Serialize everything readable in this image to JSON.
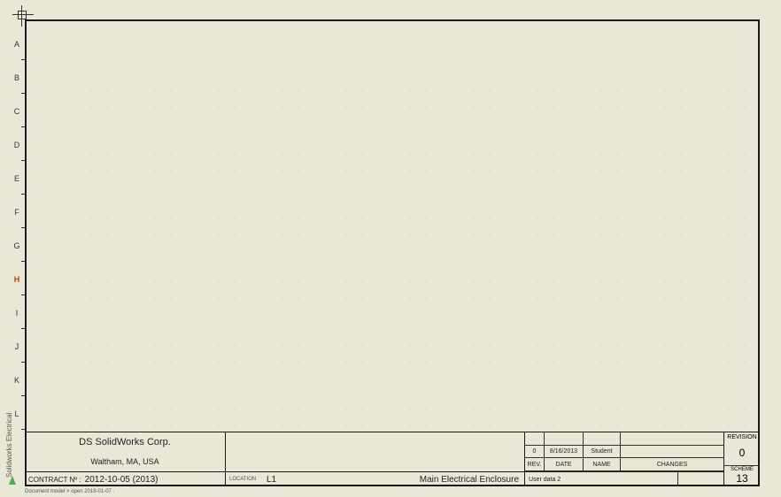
{
  "sidebar_text": "Solidworks Electrical",
  "row_labels": [
    "A",
    "B",
    "C",
    "D",
    "E",
    "F",
    "G",
    "H",
    "I",
    "J",
    "K",
    "L"
  ],
  "hot_row": "H",
  "titleblock": {
    "company": "DS SolidWorks Corp.",
    "address": "Waltham, MA, USA",
    "contract_label": "CONTRACT Nº :",
    "contract_value": "2012-10-05 (2013)",
    "location_label": "LOCATION",
    "location_value": "L1",
    "title": "Main Electrical Enclosure",
    "rev_rows": [
      {
        "rev": "",
        "date": "",
        "name": "",
        "changes": ""
      },
      {
        "rev": "0",
        "date": "8/16/2013",
        "name": "Student",
        "changes": ""
      }
    ],
    "rev_headers": {
      "rev": "REV.",
      "date": "DATE",
      "name": "NAME",
      "changes": "CHANGES"
    },
    "user_data": "User data 2",
    "revision_label": "REVISION",
    "revision_value": "0",
    "scheme_label": "SCHEME",
    "scheme_value": "13"
  },
  "footer": "Document model × open   2018-01-07 ."
}
